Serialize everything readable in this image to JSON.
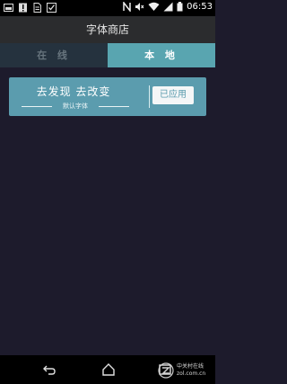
{
  "status_bar": {
    "time": "06:53",
    "left_icons": [
      "image-icon",
      "alert-icon",
      "file-icon",
      "checklist-icon"
    ],
    "right_icons": [
      "nfc-icon",
      "mute-icon",
      "wifi-icon",
      "signal-icon",
      "battery-icon"
    ]
  },
  "header": {
    "title": "字体商店"
  },
  "tabs": [
    {
      "label": "在 线",
      "selected": false
    },
    {
      "label": "本 地",
      "selected": true
    }
  ],
  "font_card": {
    "title": "去发现 去改变",
    "subtitle": "默认字体",
    "button_label": "已应用"
  },
  "navbar": {
    "icons": [
      "back-icon",
      "home-icon",
      "recent-apps-icon"
    ],
    "watermark_text_1": "中关村在线",
    "watermark_text_2": "zol.com.cn"
  },
  "colors": {
    "background": "#1d1b2c",
    "accent": "#59a5b0",
    "card": "#5b9cae"
  }
}
